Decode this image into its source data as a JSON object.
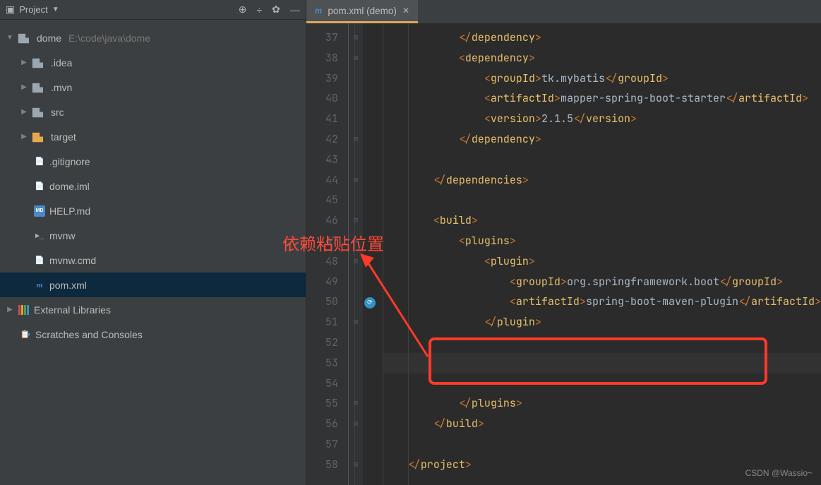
{
  "sidebar": {
    "title": "Project",
    "root": {
      "name": "dome",
      "path": "E:\\code\\java\\dome"
    },
    "folders": [
      {
        "name": ".idea",
        "orange": false
      },
      {
        "name": ".mvn",
        "orange": false
      },
      {
        "name": "src",
        "orange": false
      },
      {
        "name": "target",
        "orange": true
      }
    ],
    "files": [
      {
        "name": ".gitignore",
        "icon": "txt"
      },
      {
        "name": "dome.iml",
        "icon": "txt"
      },
      {
        "name": "HELP.md",
        "icon": "md"
      },
      {
        "name": "mvnw",
        "icon": "sh"
      },
      {
        "name": "mvnw.cmd",
        "icon": "txt"
      },
      {
        "name": "pom.xml",
        "icon": "m",
        "selected": true
      }
    ],
    "external": "External Libraries",
    "scratches": "Scratches and Consoles"
  },
  "tab": {
    "label": "pom.xml (demo)"
  },
  "lineStart": 37,
  "lineEnd": 58,
  "code": {
    "l37": {
      "pre": "            </",
      "tag": "dependency",
      "post": ">"
    },
    "l38": {
      "pre": "            <",
      "tag": "dependency",
      "post": ">"
    },
    "l39": {
      "pre": "                <",
      "tag1": "groupId",
      "val": "tk.mybatis",
      "tag2": "groupId"
    },
    "l40": {
      "pre": "                <",
      "tag1": "artifactId",
      "val": "mapper-spring-boot-starter",
      "tag2": "artifactId"
    },
    "l41": {
      "pre": "                <",
      "tag1": "version",
      "val": "2.1.5",
      "tag2": "version"
    },
    "l42": {
      "pre": "            </",
      "tag": "dependency",
      "post": ">"
    },
    "l44": {
      "pre": "        </",
      "tag": "dependencies",
      "post": ">"
    },
    "l46": {
      "pre": "        <",
      "tag": "build",
      "post": ">"
    },
    "l47": {
      "pre": "            <",
      "tag": "plugins",
      "post": ">"
    },
    "l48": {
      "pre": "                <",
      "tag": "plugin",
      "post": ">"
    },
    "l49": {
      "pre": "                    <",
      "tag1": "groupId",
      "val": "org.springframework.boot",
      "tag2": "groupId"
    },
    "l50": {
      "pre": "                    <",
      "tag1": "artifactId",
      "val": "spring-boot-maven-plugin",
      "tag2": "artifactId"
    },
    "l51": {
      "pre": "                </",
      "tag": "plugin",
      "post": ">"
    },
    "l55": {
      "pre": "            </",
      "tag": "plugins",
      "post": ">"
    },
    "l56": {
      "pre": "        </",
      "tag": "build",
      "post": ">"
    },
    "l58": {
      "pre": "    </",
      "tag": "project",
      "post": ">"
    }
  },
  "annotation": "依赖粘贴位置",
  "watermark": "CSDN @Wassio~"
}
